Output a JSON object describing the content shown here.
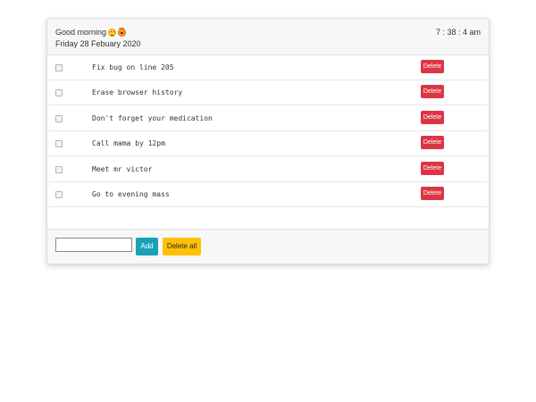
{
  "header": {
    "greeting": "Good morning",
    "greeting_emojis": [
      "smiling-face-icon",
      "sun-face-icon"
    ],
    "date": "Friday 28 Febuary 2020",
    "time": "7 : 38 : 4 am"
  },
  "todos": [
    {
      "text": "Fix bug on line 205",
      "checked": false,
      "delete_label": "Delete"
    },
    {
      "text": "Erase browser history",
      "checked": false,
      "delete_label": "Delete"
    },
    {
      "text": "Don't forget your medication",
      "checked": false,
      "delete_label": "Delete"
    },
    {
      "text": "Call mama by 12pm",
      "checked": false,
      "delete_label": "Delete"
    },
    {
      "text": "Meet mr victor",
      "checked": false,
      "delete_label": "Delete"
    },
    {
      "text": "Go to evening mass",
      "checked": false,
      "delete_label": "Delete"
    }
  ],
  "footer": {
    "input_value": "",
    "add_label": "Add",
    "delete_all_label": "Delete all"
  },
  "colors": {
    "delete": "#dc3545",
    "add": "#17a2b8",
    "delete_all": "#ffc107",
    "header_bg": "#f7f7f7"
  }
}
